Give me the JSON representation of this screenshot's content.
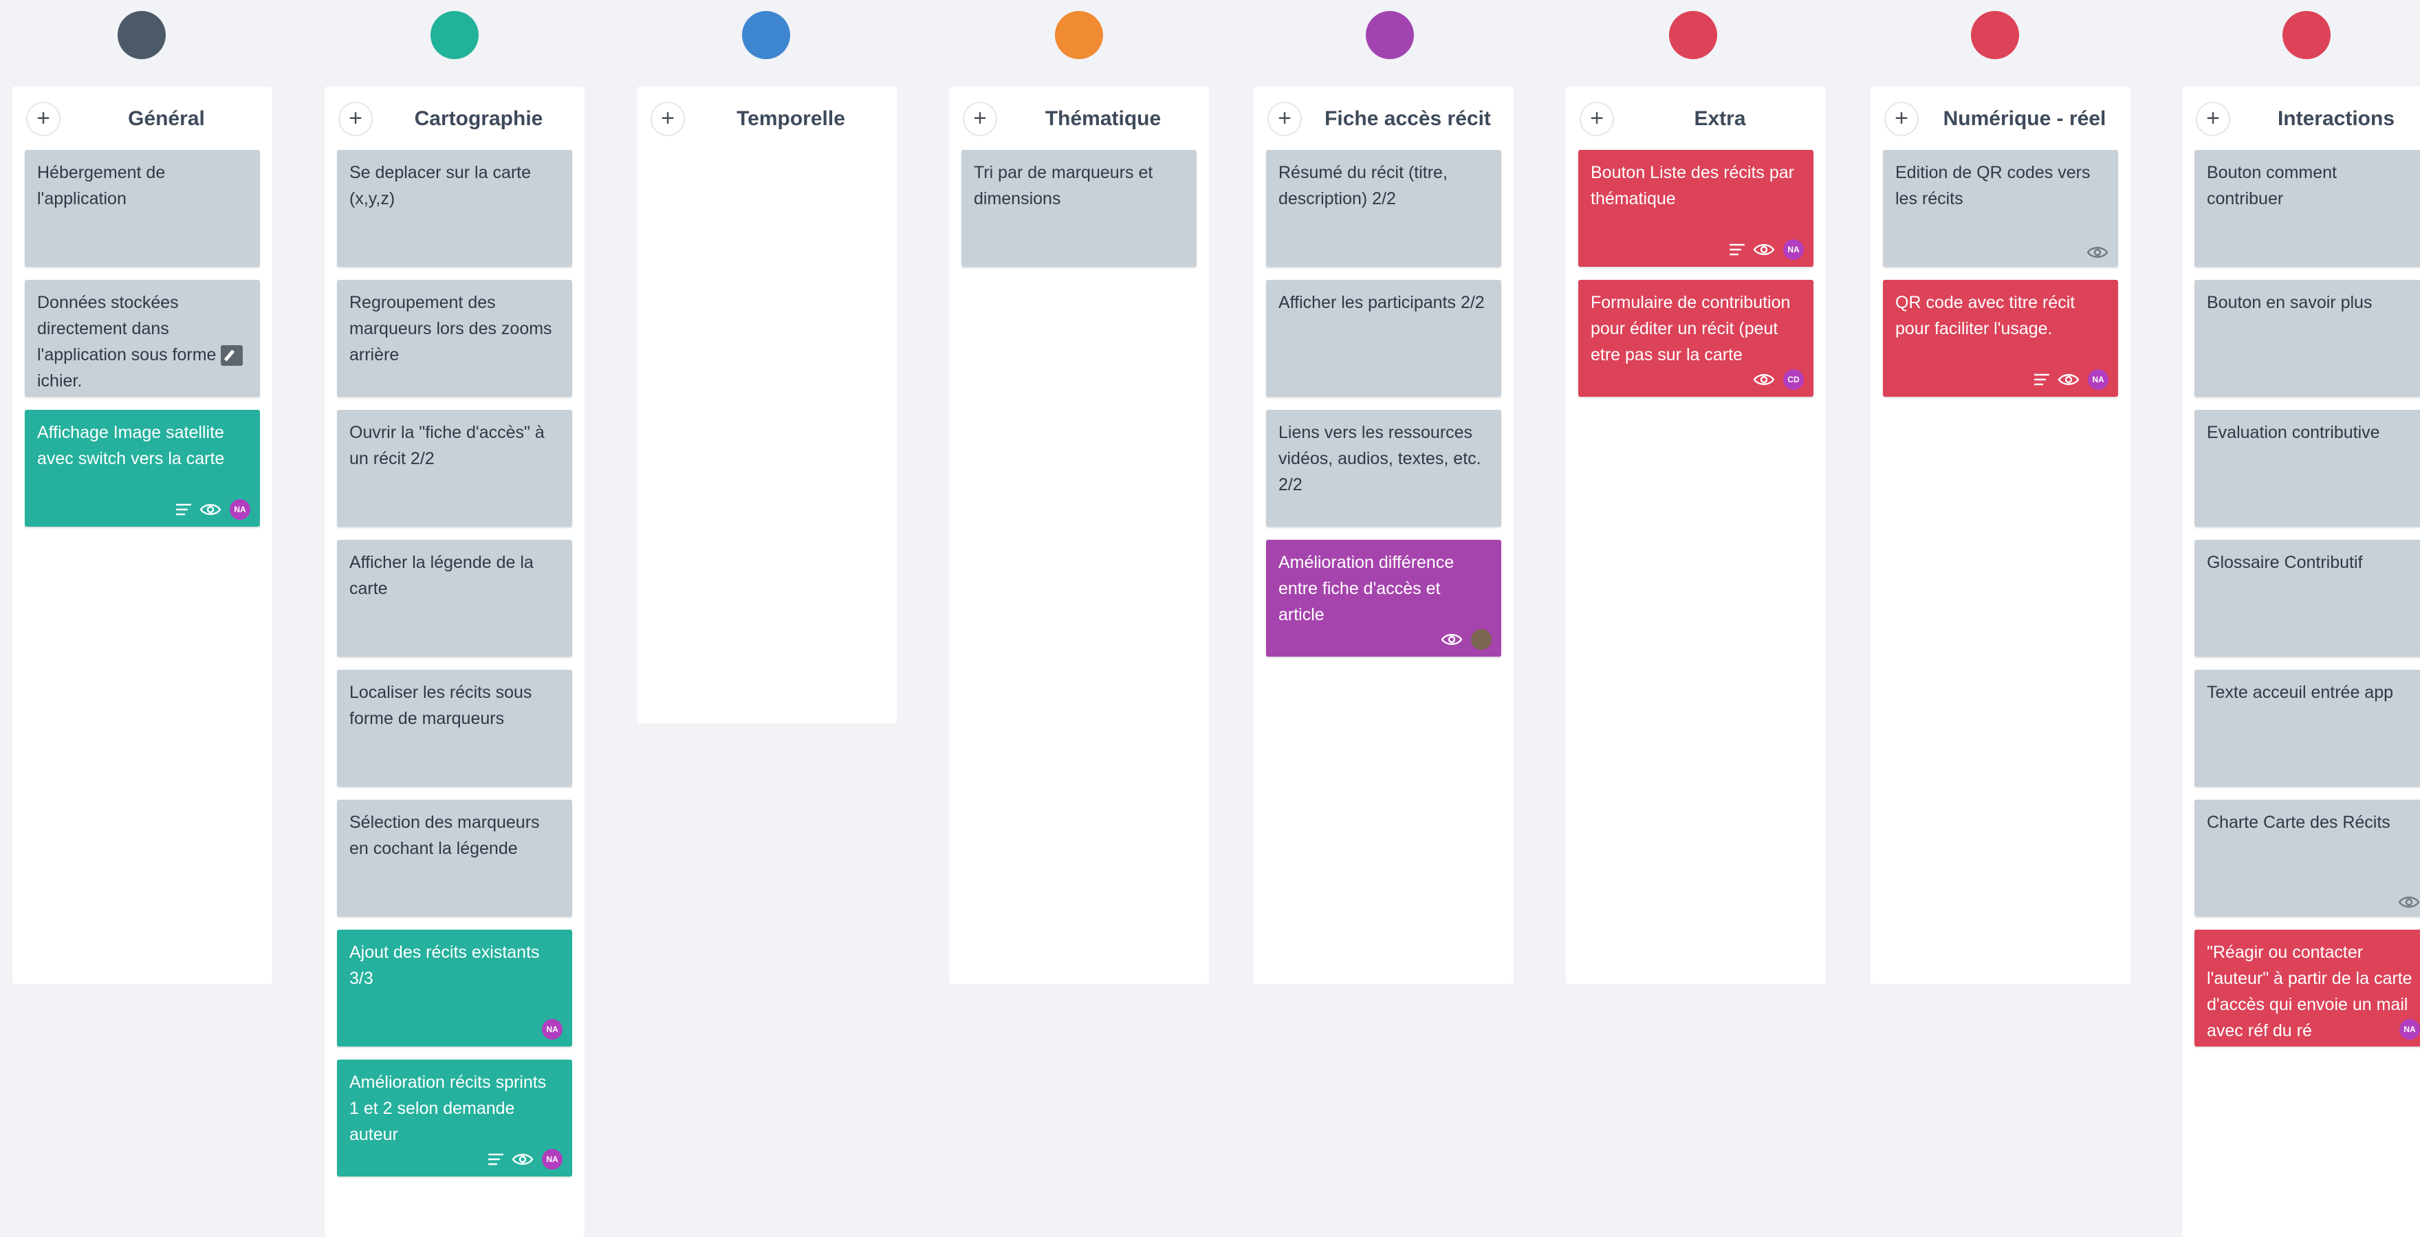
{
  "columns": [
    {
      "title": "Général",
      "color": "#4b5968",
      "cards": [
        {
          "text": "Hébergement de l'application",
          "color": "gray",
          "icons": []
        },
        {
          "text": "Données stockées directement dans l'application sous forme",
          "text_after_icon": "ichier.",
          "color": "gray",
          "icons": []
        },
        {
          "text": "Affichage Image satellite avec switch vers la carte",
          "color": "teal",
          "icons": [
            "description-icon",
            "watch-icon"
          ],
          "avatar": "NA"
        }
      ]
    },
    {
      "title": "Cartographie",
      "color": "#21b39a",
      "cards": [
        {
          "text": "Se deplacer sur la carte (x,y,z)",
          "color": "gray",
          "icons": []
        },
        {
          "text": "Regroupement des marqueurs lors des zooms arrière",
          "color": "gray",
          "icons": []
        },
        {
          "text": "Ouvrir la \"fiche d'accès\" à un récit 2/2",
          "color": "gray",
          "icons": []
        },
        {
          "text": "Afficher la légende de la carte",
          "color": "gray",
          "icons": []
        },
        {
          "text": "Localiser les récits sous forme de marqueurs",
          "color": "gray",
          "icons": []
        },
        {
          "text": "Sélection des marqueurs en cochant la légende",
          "color": "gray",
          "icons": []
        },
        {
          "text": "Ajout des récits existants 3/3",
          "color": "teal",
          "icons": [],
          "avatar": "NA"
        },
        {
          "text": "Amélioration récits sprints 1 et 2 selon demande auteur",
          "color": "teal",
          "icons": [
            "description-icon",
            "watch-icon"
          ],
          "avatar": "NA"
        }
      ]
    },
    {
      "title": "Temporelle",
      "color": "#3f86d1",
      "cards": []
    },
    {
      "title": "Thématique",
      "color": "#f08a33",
      "cards": [
        {
          "text": "Tri par de marqueurs et dimensions",
          "color": "gray",
          "icons": []
        }
      ]
    },
    {
      "title": "Fiche accès récit",
      "color": "#a244b0",
      "cards": [
        {
          "text": "Résumé du récit (titre, description) 2/2",
          "color": "gray",
          "icons": []
        },
        {
          "text": "Afficher les participants 2/2",
          "color": "gray",
          "icons": []
        },
        {
          "text": "Liens vers les ressources vidéos, audios, textes, etc. 2/2",
          "color": "gray",
          "icons": []
        },
        {
          "text": "Amélioration différence entre fiche d'accès et article",
          "color": "purple",
          "icons": [
            "watch-icon"
          ],
          "avatar_photo": true
        }
      ]
    },
    {
      "title": "Extra",
      "color": "#dc4258",
      "cards": [
        {
          "text": "Bouton Liste des récits par thématique",
          "color": "red",
          "icons": [
            "description-icon",
            "watch-icon"
          ],
          "avatar": "NA"
        },
        {
          "text": "Formulaire de contribution pour éditer un récit (peut etre pas sur la carte",
          "color": "red",
          "icons": [
            "watch-icon"
          ],
          "avatar": "CD"
        }
      ]
    },
    {
      "title": "Numérique - réel",
      "color": "#dc4258",
      "cards": [
        {
          "text": "Edition de QR codes vers les récits",
          "color": "gray",
          "icons": [
            "watch-icon"
          ]
        },
        {
          "text": "QR code avec titre récit pour faciliter l'usage.",
          "color": "red",
          "icons": [
            "description-icon",
            "watch-icon"
          ],
          "avatar": "NA"
        }
      ]
    },
    {
      "title": "Interactions",
      "color": "#dc4258",
      "cards": [
        {
          "text": "Bouton comment contribuer",
          "color": "gray",
          "icons": []
        },
        {
          "text": "Bouton en savoir plus",
          "color": "gray",
          "icons": []
        },
        {
          "text": "Evaluation contributive",
          "color": "gray",
          "icons": []
        },
        {
          "text": "Glossaire Contributif",
          "color": "gray",
          "icons": []
        },
        {
          "text": "Texte acceuil  entrée app",
          "color": "gray",
          "icons": []
        },
        {
          "text": "Charte Carte des Récits",
          "color": "gray",
          "icons": [
            "watch-icon"
          ]
        },
        {
          "text": "\"Réagir ou contacter l'auteur\" à partir de la carte d'accès qui envoie un mail avec réf du ré",
          "color": "red",
          "icons": [],
          "avatar": "NA"
        }
      ]
    }
  ]
}
